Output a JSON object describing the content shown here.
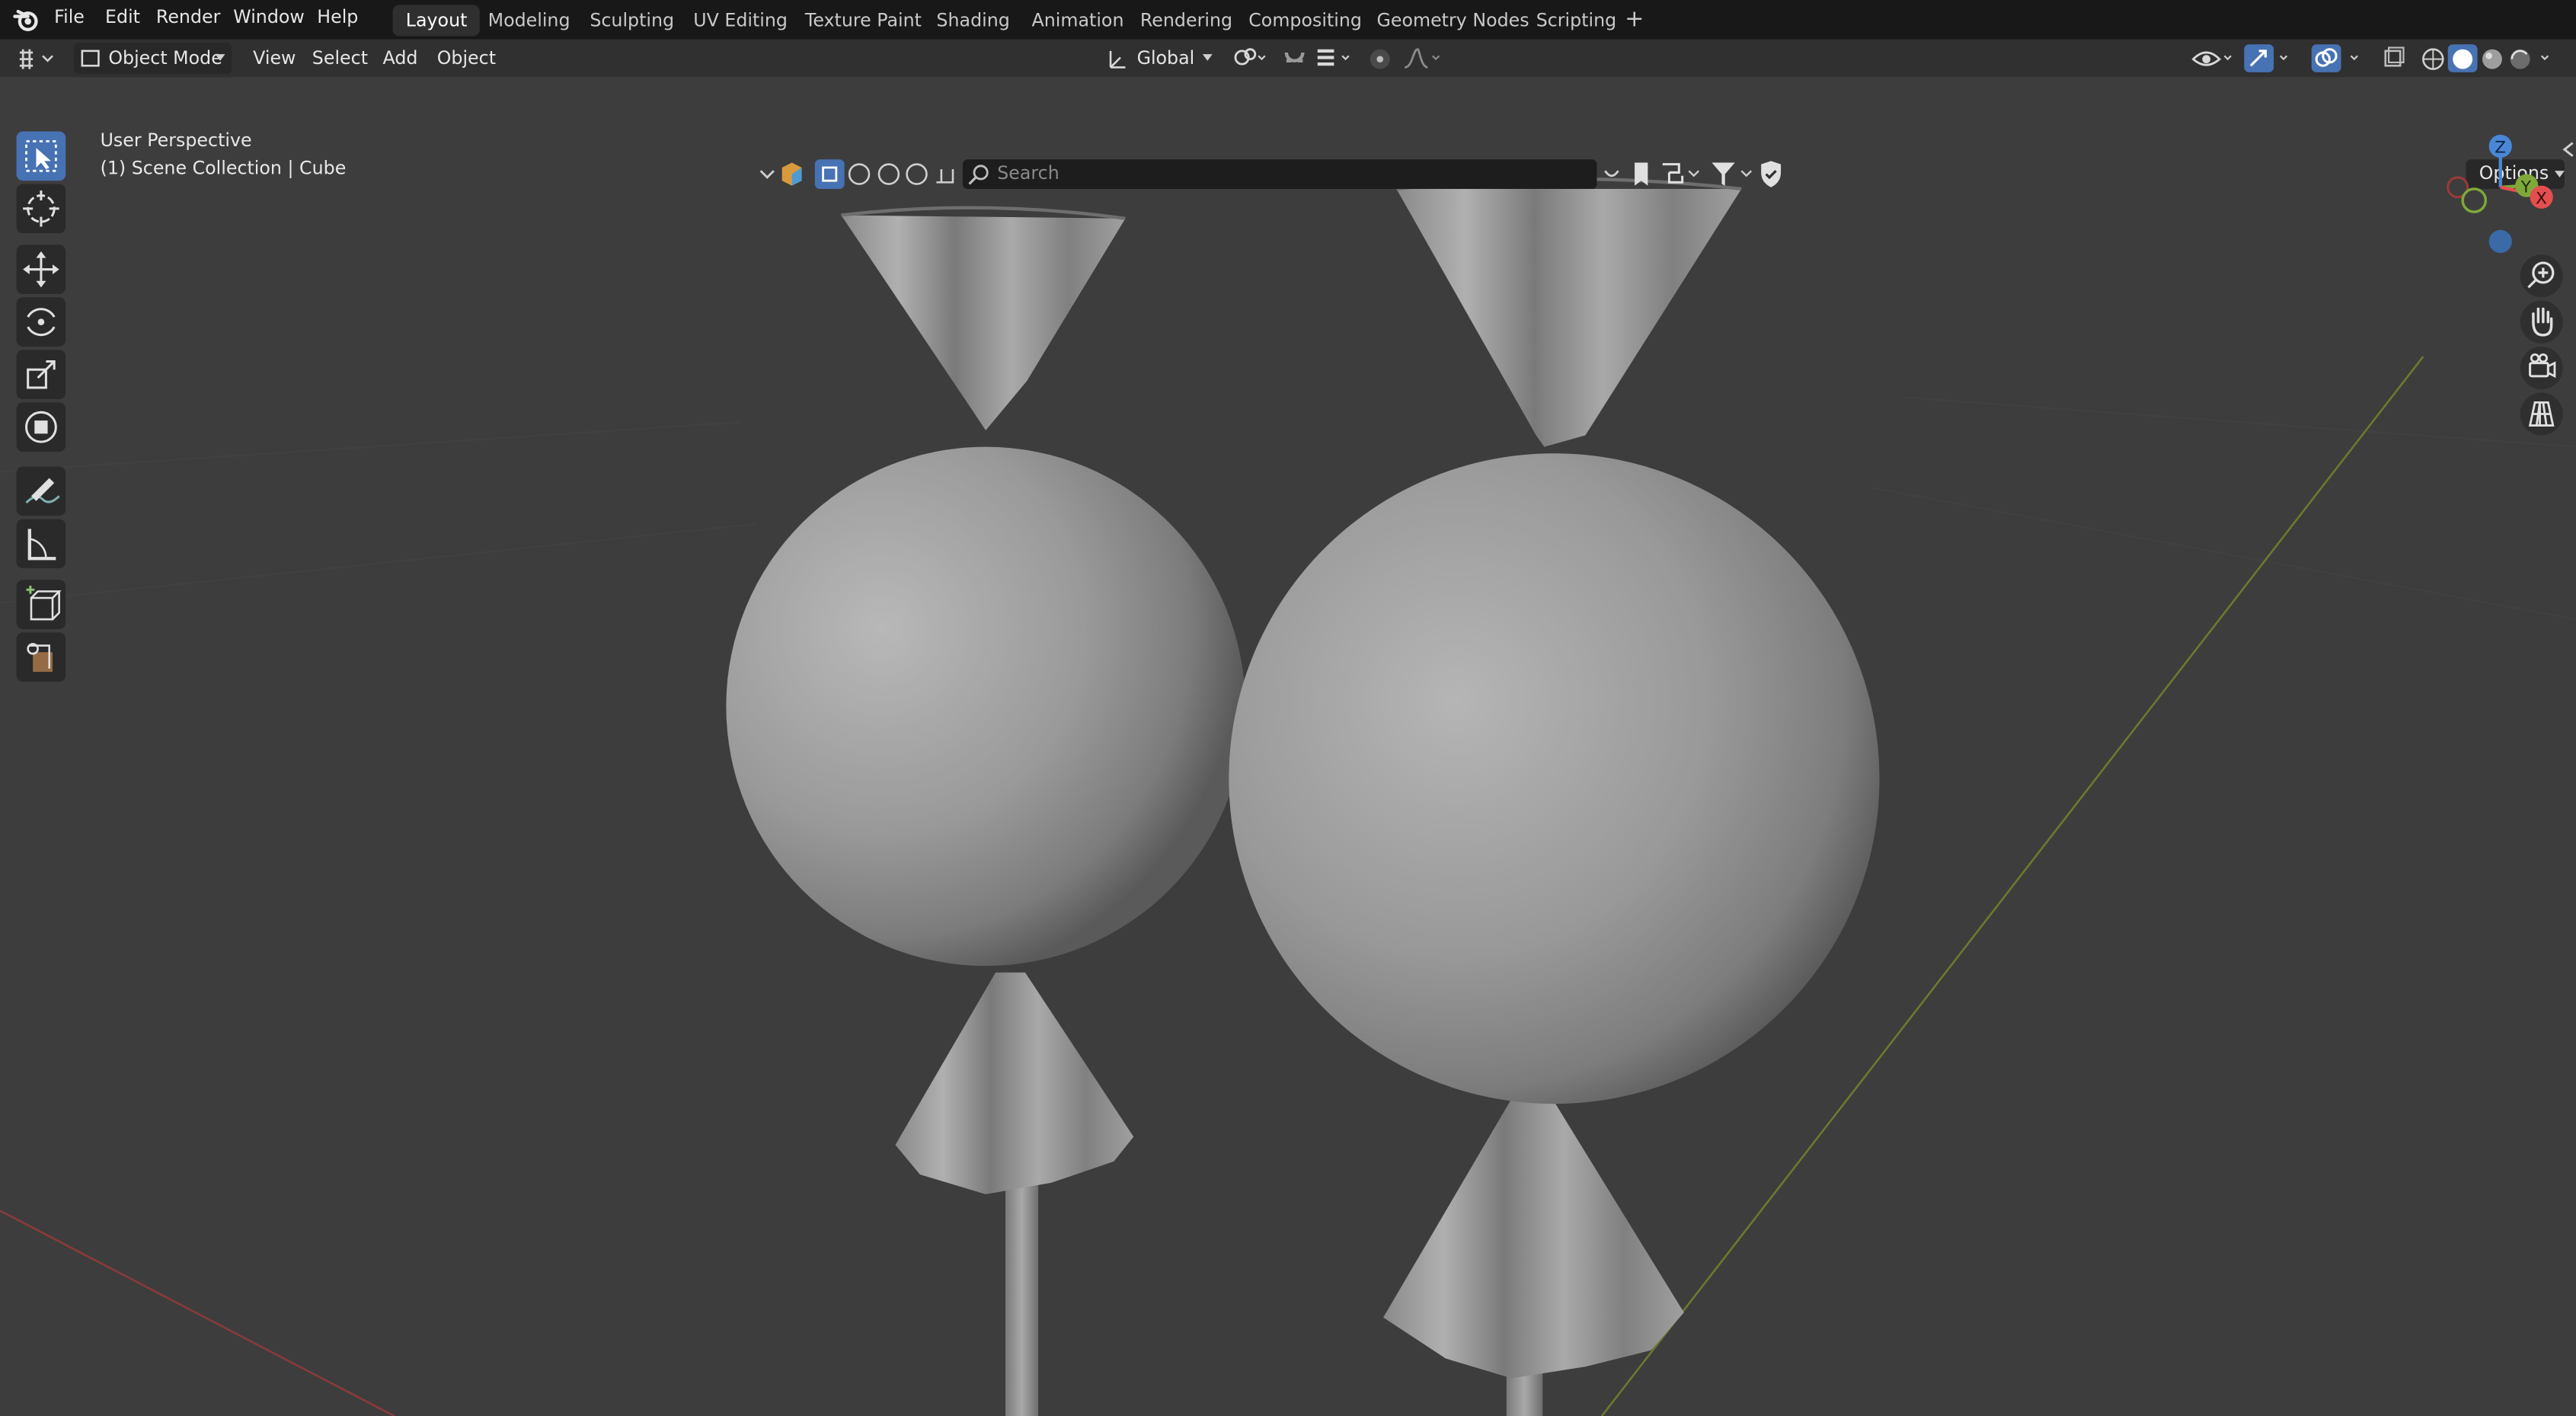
{
  "top_menu": {
    "items": [
      "File",
      "Edit",
      "Render",
      "Window",
      "Help"
    ]
  },
  "workspaces": {
    "tabs": [
      "Layout",
      "Modeling",
      "Sculpting",
      "UV Editing",
      "Texture Paint",
      "Shading",
      "Animation",
      "Rendering",
      "Compositing",
      "Geometry Nodes",
      "Scripting"
    ],
    "active": "Layout",
    "add_label": "+"
  },
  "header": {
    "mode": "Object Mode",
    "menus": [
      "View",
      "Select",
      "Add",
      "Object"
    ],
    "transform_orientation": "Global"
  },
  "viewport": {
    "view_name": "User Perspective",
    "collection_info": "(1) Scene Collection | Cube",
    "search_placeholder": "Search",
    "options_label": "Options"
  },
  "gizmo": {
    "z": "Z",
    "y": "Y",
    "x": "X"
  },
  "colors": {
    "accent": "#4772b3",
    "background": "#3d3d3d",
    "x_axis": "#e34e4e",
    "y_axis": "#7fa83a",
    "z_axis": "#4a87d6"
  }
}
